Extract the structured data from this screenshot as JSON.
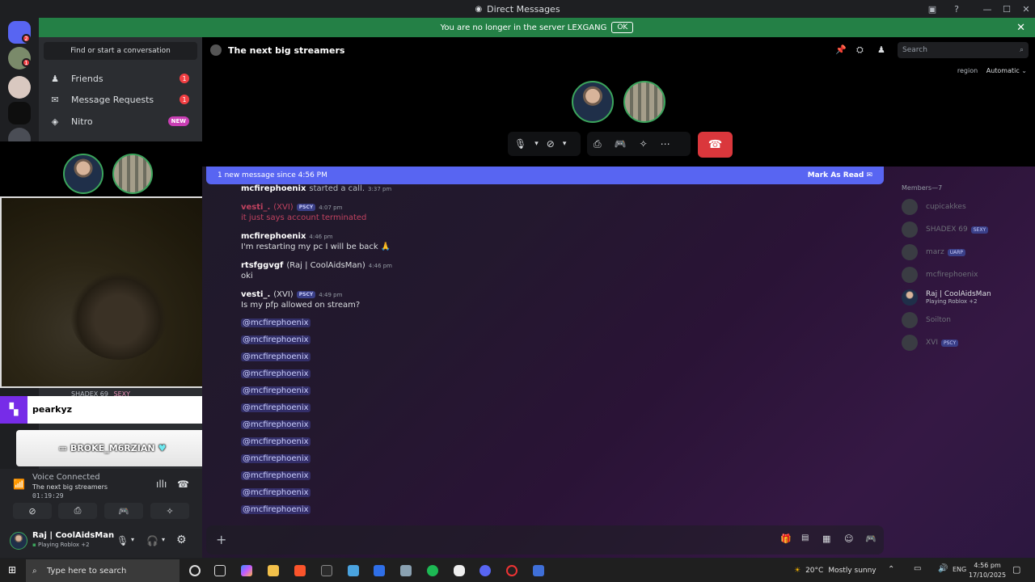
{
  "window": {
    "title": "Direct Messages"
  },
  "banner": {
    "text": "You are no longer in the server LEXGANG",
    "ok_label": "OK"
  },
  "guild_badges": {
    "discord": "2",
    "avatar": "1"
  },
  "dm_sidebar": {
    "find_label": "Find or start a conversation",
    "items": [
      {
        "label": "Friends",
        "badge": "1",
        "icon": "friends-icon"
      },
      {
        "label": "Message Requests",
        "badge": "1",
        "icon": "mail-icon"
      },
      {
        "label": "Nitro",
        "badge": "NEW",
        "icon": "nitro-icon"
      }
    ]
  },
  "overlay": {
    "twitch_name": "pearkyz",
    "chatter": "BROKE_M6RZIAN",
    "behind_text": "SHADEX 69",
    "behind_tag": "SEXY"
  },
  "voice": {
    "status": "Voice Connected",
    "channel": "The next big streamers",
    "time": "01:19:29"
  },
  "user": {
    "name": "Raj | CoolAidsMan",
    "status": "Playing Roblox +2"
  },
  "chat": {
    "title": "The next big streamers",
    "search_placeholder": "Search",
    "region_label": "region",
    "region_value": "Automatic",
    "new_message_bar": "1 new message since 4:56 PM",
    "mark_as_read": "Mark As Read"
  },
  "messages": [
    {
      "author": "mcfirephoenix",
      "text": "started a call.",
      "time": "3:37 pm",
      "system": true
    },
    {
      "author": "vesti_.",
      "nick": "(XVI)",
      "tag": "PSCY",
      "time": "4:07 pm",
      "text": "it just says account terminated",
      "dim": true
    },
    {
      "author": "mcfirephoenix",
      "time": "4:46 pm",
      "text": "I'm restarting my pc I will be back 🙏"
    },
    {
      "author": "rtsfggvgf",
      "nick": "(Raj | CoolAidsMan)",
      "time": "4:46 pm",
      "text": "oki"
    },
    {
      "author": "vesti_.",
      "nick": "(XVI)",
      "tag": "PSCY",
      "time": "4:49 pm",
      "text": "Is my pfp allowed on stream?"
    }
  ],
  "mention_text": "@mcfirephoenix",
  "members": {
    "header": "Members—7",
    "list": [
      {
        "name": "cupicakkes"
      },
      {
        "name": "SHADEX 69",
        "tag": "SEXY"
      },
      {
        "name": "marz",
        "tag": "UARP"
      },
      {
        "name": "mcfirephoenix"
      },
      {
        "name": "Raj | CoolAidsMan",
        "status": "Playing Roblox +2",
        "active": true
      },
      {
        "name": "Soilton"
      },
      {
        "name": "XVI",
        "tag": "PSCY"
      }
    ]
  },
  "taskbar": {
    "search_placeholder": "Type here to search",
    "temperature": "20°C",
    "weather": "Mostly sunny",
    "lang": "ENG",
    "time": "4:56 pm",
    "date": "17/10/2025"
  },
  "colors": {
    "accent": "#5865f2",
    "danger": "#da373c",
    "online": "#3ba55c",
    "banner": "#248046"
  }
}
